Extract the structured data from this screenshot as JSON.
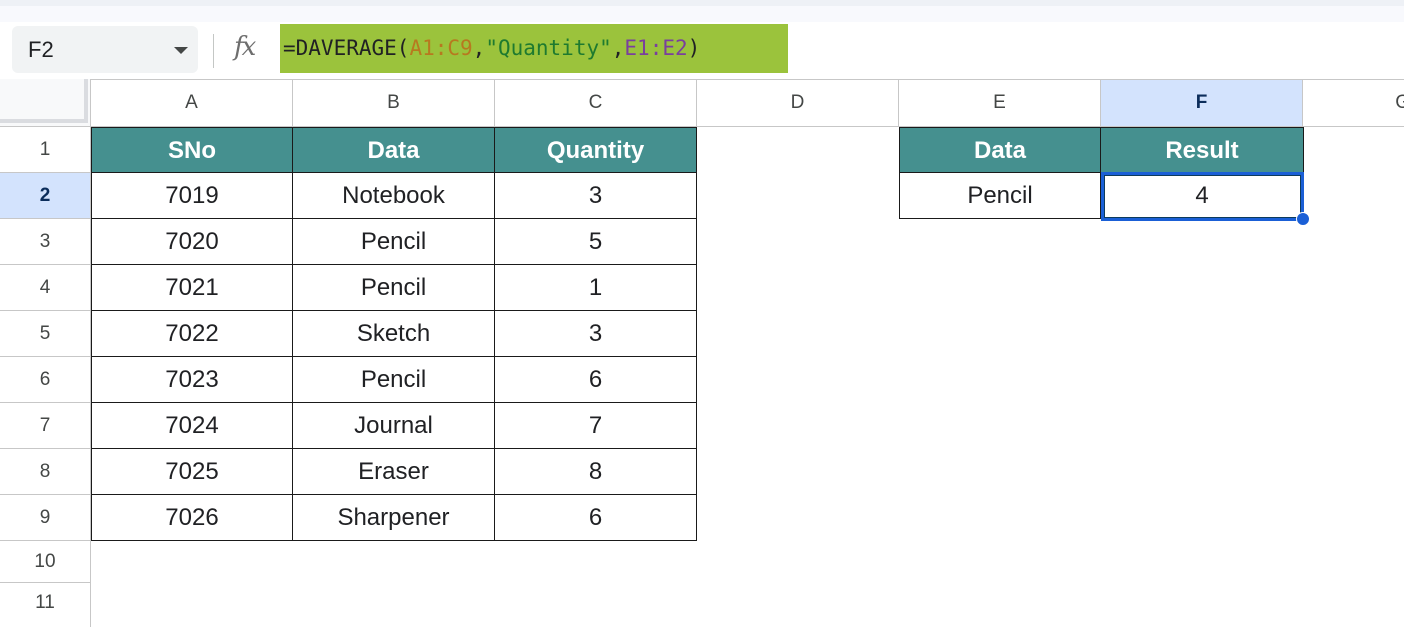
{
  "formula_bar": {
    "name_box": "F2",
    "fx_label": "fx",
    "formula_parts": {
      "eq": "=DAVERAGE(",
      "range1": "A1:C9",
      "comma1": ",",
      "field": "\"Quantity\"",
      "comma2": ",",
      "range2": "E1:E2",
      "close": ")"
    }
  },
  "columns": [
    "A",
    "B",
    "C",
    "D",
    "E",
    "F",
    "G"
  ],
  "rows": [
    "1",
    "2",
    "3",
    "4",
    "5",
    "6",
    "7",
    "8",
    "9",
    "10",
    "11"
  ],
  "selected_cell": "F2",
  "table": {
    "headers": [
      "SNo",
      "Data",
      "Quantity"
    ],
    "rows": [
      [
        "7019",
        "Notebook",
        "3"
      ],
      [
        "7020",
        "Pencil",
        "5"
      ],
      [
        "7021",
        "Pencil",
        "1"
      ],
      [
        "7022",
        "Sketch",
        "3"
      ],
      [
        "7023",
        "Pencil",
        "6"
      ],
      [
        "7024",
        "Journal",
        "7"
      ],
      [
        "7025",
        "Eraser",
        "8"
      ],
      [
        "7026",
        "Sharpener",
        "6"
      ]
    ]
  },
  "criteria": {
    "headers": [
      "Data",
      "Result"
    ],
    "values": [
      "Pencil",
      "4"
    ]
  },
  "colors": {
    "header_fill": "#45908f",
    "formula_highlight": "#9bc33c",
    "selection": "#1a5fd6",
    "selected_header": "#d3e3fd"
  }
}
